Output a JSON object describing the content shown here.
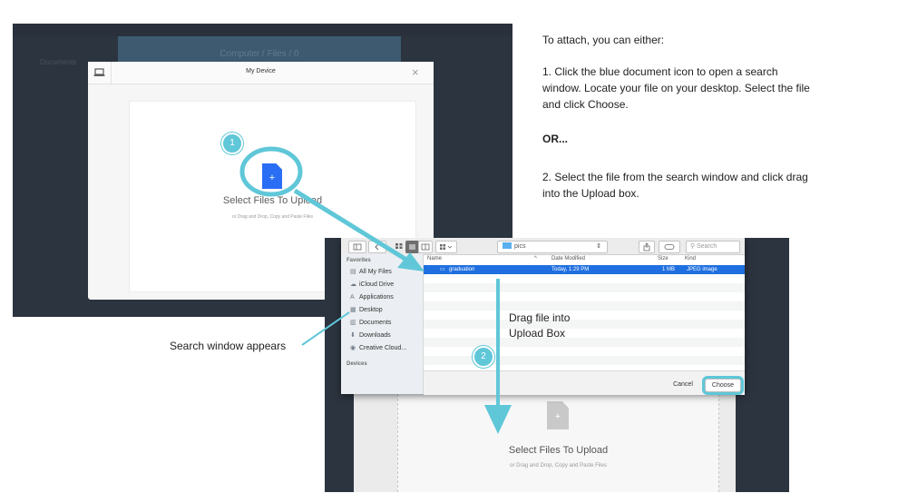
{
  "top_shot": {
    "background_banner": "Computer / Files / 0",
    "background_left": "Documents",
    "modal": {
      "title": "My Device",
      "close": "×",
      "drop_title": "Select Files To Upload",
      "drop_sub": "or Drag and Drop, Copy and Paste Files",
      "doc_plus": "+"
    }
  },
  "callouts": {
    "one": "1",
    "two": "2"
  },
  "instructions": {
    "intro": "To attach, you can either:",
    "step1_l1": "1. Click the blue document icon to open a search",
    "step1_l2": "window. Locate your file on your desktop. Select the file",
    "step1_l3": "and click Choose.",
    "or": "OR...",
    "step2_l1": "2. Select the file from the search window and click drag",
    "step2_l2": "into the Upload box."
  },
  "labels": {
    "search_window": "Search window appears",
    "drag_l1": "Drag file into",
    "drag_l2": "Upload Box"
  },
  "finder": {
    "folder": "pics",
    "search_placeholder": "Search",
    "favorites": "Favorites",
    "sidebar_items": [
      "All My Files",
      "iCloud Drive",
      "Applications",
      "Desktop",
      "Documents",
      "Downloads",
      "Creative Cloud..."
    ],
    "devices": "Devices",
    "columns": {
      "name": "Name",
      "date": "Date Modified",
      "size": "Size",
      "kind": "Kind"
    },
    "row": {
      "name": "graduation",
      "date": "Today, 1:29 PM",
      "size": "1 MB",
      "kind": "JPEG image"
    },
    "cancel": "Cancel",
    "choose": "Choose"
  },
  "bottom_upload": {
    "drop_title": "Select Files To Upload",
    "drop_sub": "or Drag and Drop, Copy and Paste Files",
    "doc_plus": "+"
  }
}
